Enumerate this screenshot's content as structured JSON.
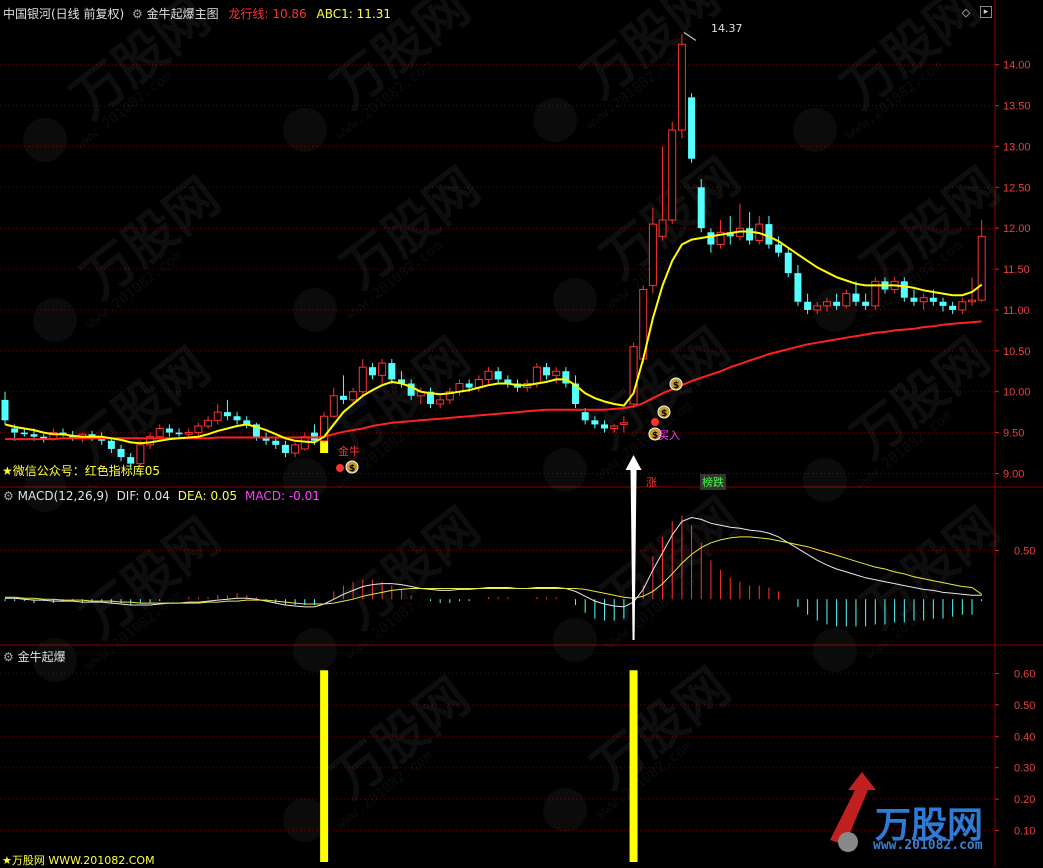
{
  "main_header": {
    "security": "中国银河(日线 前复权)",
    "indicator": "金牛起爆主图",
    "line1_label": "龙行线:",
    "line1_value": "10.86",
    "line2_label": "ABC1:",
    "line2_value": "11.31"
  },
  "macd_header": {
    "name": "MACD(12,26,9)",
    "dif_label": "DIF:",
    "dif_value": "0.04",
    "dea_label": "DEA:",
    "dea_value": "0.05",
    "macd_label": "MACD:",
    "macd_value": "-0.01"
  },
  "sub_header": {
    "name": "金牛起爆"
  },
  "annotations": {
    "wechat": "★微信公众号：红色指标库05",
    "high_price": "14.37",
    "jinniu": "金牛",
    "buy": "买入",
    "up_label": "涨",
    "rank_label": "榜跌"
  },
  "watermark": {
    "brand": "万股网",
    "url_footer": "WWW.201082.COM",
    "url_logo": "www.201082.com",
    "footer_brand": "万股网"
  },
  "colors": {
    "up": "#ff3232",
    "down": "#54ffff",
    "yellow": "#ffff00",
    "ma_red": "#ff2020",
    "grid": "#8b0000"
  },
  "icons": [
    "gear-icon",
    "diamond-icon",
    "expand-icon",
    "money-bag-icon",
    "up-arrow-icon"
  ],
  "chart_data": [
    {
      "type": "candlestick",
      "title": "金牛起爆主图",
      "y_ticks": [
        "9.00",
        "9.50",
        "10.00",
        "10.50",
        "11.00",
        "11.50",
        "12.00",
        "12.50",
        "13.00",
        "13.50",
        "14.00"
      ],
      "ylim": [
        8.92,
        14.62
      ],
      "candles": [
        [
          9.9,
          10.0,
          9.6,
          9.65
        ],
        [
          9.55,
          9.6,
          9.4,
          9.5
        ],
        [
          9.5,
          9.55,
          9.45,
          9.48
        ],
        [
          9.48,
          9.55,
          9.4,
          9.45
        ],
        [
          9.45,
          9.48,
          9.38,
          9.42
        ],
        [
          9.42,
          9.55,
          9.4,
          9.5
        ],
        [
          9.5,
          9.55,
          9.45,
          9.47
        ],
        [
          9.47,
          9.52,
          9.4,
          9.44
        ],
        [
          9.44,
          9.5,
          9.38,
          9.48
        ],
        [
          9.48,
          9.52,
          9.4,
          9.42
        ],
        [
          9.42,
          9.5,
          9.35,
          9.4
        ],
        [
          9.4,
          9.42,
          9.25,
          9.3
        ],
        [
          9.3,
          9.35,
          9.15,
          9.2
        ],
        [
          9.2,
          9.25,
          9.05,
          9.12
        ],
        [
          9.12,
          9.4,
          9.1,
          9.35
        ],
        [
          9.35,
          9.5,
          9.3,
          9.45
        ],
        [
          9.45,
          9.6,
          9.4,
          9.55
        ],
        [
          9.55,
          9.6,
          9.45,
          9.5
        ],
        [
          9.5,
          9.55,
          9.45,
          9.48
        ],
        [
          9.48,
          9.55,
          9.42,
          9.5
        ],
        [
          9.5,
          9.62,
          9.45,
          9.58
        ],
        [
          9.58,
          9.7,
          9.55,
          9.65
        ],
        [
          9.65,
          9.85,
          9.6,
          9.75
        ],
        [
          9.75,
          9.9,
          9.65,
          9.7
        ],
        [
          9.7,
          9.75,
          9.6,
          9.65
        ],
        [
          9.65,
          9.7,
          9.55,
          9.6
        ],
        [
          9.6,
          9.62,
          9.4,
          9.45
        ],
        [
          9.45,
          9.5,
          9.35,
          9.4
        ],
        [
          9.4,
          9.45,
          9.3,
          9.35
        ],
        [
          9.35,
          9.4,
          9.2,
          9.25
        ],
        [
          9.25,
          9.38,
          9.2,
          9.35
        ],
        [
          9.3,
          9.5,
          9.28,
          9.45
        ],
        [
          9.5,
          9.6,
          9.35,
          9.4
        ],
        [
          9.4,
          9.75,
          9.38,
          9.7
        ],
        [
          9.7,
          10.05,
          9.68,
          9.95
        ],
        [
          9.95,
          10.2,
          9.85,
          9.9
        ],
        [
          9.9,
          10.05,
          9.85,
          10.0
        ],
        [
          10.0,
          10.4,
          9.95,
          10.3
        ],
        [
          10.3,
          10.35,
          10.15,
          10.2
        ],
        [
          10.2,
          10.4,
          10.1,
          10.35
        ],
        [
          10.35,
          10.4,
          10.1,
          10.15
        ],
        [
          10.15,
          10.25,
          10.05,
          10.1
        ],
        [
          10.1,
          10.15,
          9.9,
          9.95
        ],
        [
          9.95,
          10.05,
          9.85,
          10.0
        ],
        [
          10.0,
          10.05,
          9.8,
          9.85
        ],
        [
          9.85,
          9.95,
          9.8,
          9.9
        ],
        [
          9.9,
          10.05,
          9.85,
          10.0
        ],
        [
          10.0,
          10.15,
          9.95,
          10.1
        ],
        [
          10.1,
          10.15,
          10.0,
          10.05
        ],
        [
          10.05,
          10.2,
          10.0,
          10.15
        ],
        [
          10.15,
          10.3,
          10.1,
          10.25
        ],
        [
          10.25,
          10.3,
          10.1,
          10.15
        ],
        [
          10.15,
          10.2,
          10.05,
          10.1
        ],
        [
          10.1,
          10.15,
          10.0,
          10.05
        ],
        [
          10.05,
          10.15,
          10.0,
          10.1
        ],
        [
          10.1,
          10.35,
          10.05,
          10.3
        ],
        [
          10.3,
          10.35,
          10.15,
          10.2
        ],
        [
          10.2,
          10.3,
          10.1,
          10.25
        ],
        [
          10.25,
          10.3,
          10.05,
          10.1
        ],
        [
          10.1,
          10.2,
          9.8,
          9.85
        ],
        [
          9.75,
          9.8,
          9.6,
          9.65
        ],
        [
          9.65,
          9.7,
          9.55,
          9.6
        ],
        [
          9.6,
          9.65,
          9.5,
          9.55
        ],
        [
          9.55,
          9.6,
          9.5,
          9.58
        ],
        [
          9.6,
          9.7,
          9.5,
          9.62
        ],
        [
          9.85,
          10.6,
          9.8,
          10.55
        ],
        [
          10.4,
          11.3,
          10.35,
          11.25
        ],
        [
          11.3,
          12.25,
          11.2,
          12.05
        ],
        [
          11.9,
          13.0,
          11.85,
          12.1
        ],
        [
          12.1,
          13.3,
          12.05,
          13.2
        ],
        [
          13.2,
          14.37,
          13.1,
          14.25
        ],
        [
          13.6,
          13.65,
          12.8,
          12.85
        ],
        [
          12.5,
          12.6,
          11.95,
          12.0
        ],
        [
          11.95,
          12.0,
          11.7,
          11.8
        ],
        [
          11.8,
          12.1,
          11.75,
          11.95
        ],
        [
          11.95,
          12.15,
          11.8,
          11.9
        ],
        [
          11.9,
          12.3,
          11.85,
          12.0
        ],
        [
          12.0,
          12.2,
          11.8,
          11.85
        ],
        [
          11.85,
          12.15,
          11.8,
          12.05
        ],
        [
          12.05,
          12.15,
          11.75,
          11.8
        ],
        [
          11.8,
          11.9,
          11.65,
          11.7
        ],
        [
          11.7,
          11.75,
          11.4,
          11.45
        ],
        [
          11.45,
          11.55,
          11.05,
          11.1
        ],
        [
          11.1,
          11.2,
          10.95,
          11.0
        ],
        [
          11.0,
          11.1,
          10.95,
          11.05
        ],
        [
          11.05,
          11.15,
          10.98,
          11.1
        ],
        [
          11.1,
          11.2,
          11.0,
          11.05
        ],
        [
          11.05,
          11.25,
          11.02,
          11.2
        ],
        [
          11.2,
          11.35,
          11.05,
          11.1
        ],
        [
          11.1,
          11.2,
          11.0,
          11.05
        ],
        [
          11.05,
          11.4,
          11.0,
          11.35
        ],
        [
          11.35,
          11.4,
          11.2,
          11.25
        ],
        [
          11.25,
          11.4,
          11.2,
          11.35
        ],
        [
          11.35,
          11.4,
          11.1,
          11.15
        ],
        [
          11.15,
          11.25,
          11.05,
          11.1
        ],
        [
          11.1,
          11.2,
          11.0,
          11.15
        ],
        [
          11.15,
          11.25,
          11.05,
          11.1
        ],
        [
          11.1,
          11.15,
          10.98,
          11.05
        ],
        [
          11.05,
          11.1,
          10.95,
          11.0
        ],
        [
          11.0,
          11.15,
          10.95,
          11.1
        ],
        [
          11.1,
          11.4,
          11.05,
          11.12
        ],
        [
          11.12,
          12.1,
          11.1,
          11.9
        ]
      ],
      "line_yellow": [
        9.6,
        9.57,
        9.55,
        9.53,
        9.5,
        9.48,
        9.48,
        9.46,
        9.45,
        9.45,
        9.45,
        9.43,
        9.41,
        9.38,
        9.37,
        9.38,
        9.4,
        9.42,
        9.43,
        9.44,
        9.45,
        9.48,
        9.52,
        9.55,
        9.58,
        9.6,
        9.57,
        9.53,
        9.48,
        9.43,
        9.4,
        9.39,
        9.38,
        9.45,
        9.6,
        9.75,
        9.85,
        9.95,
        10.02,
        10.08,
        10.12,
        10.1,
        10.06,
        10.0,
        9.98,
        9.97,
        9.98,
        10.0,
        10.02,
        10.05,
        10.08,
        10.1,
        10.1,
        10.08,
        10.08,
        10.1,
        10.12,
        10.15,
        10.15,
        10.08,
        9.98,
        9.92,
        9.88,
        9.85,
        9.83,
        9.98,
        10.4,
        10.9,
        11.3,
        11.6,
        11.8,
        11.86,
        11.88,
        11.9,
        11.92,
        11.94,
        11.96,
        11.96,
        11.94,
        11.9,
        11.84,
        11.76,
        11.68,
        11.6,
        11.52,
        11.46,
        11.4,
        11.36,
        11.32,
        11.3,
        11.3,
        11.3,
        11.3,
        11.29,
        11.27,
        11.24,
        11.22,
        11.2,
        11.18,
        11.18,
        11.22,
        11.31
      ],
      "line_red": [
        9.42,
        9.42,
        9.42,
        9.42,
        9.42,
        9.42,
        9.43,
        9.43,
        9.43,
        9.43,
        9.43,
        9.43,
        9.43,
        9.43,
        9.43,
        9.43,
        9.43,
        9.43,
        9.43,
        9.43,
        9.43,
        9.43,
        9.44,
        9.44,
        9.44,
        9.44,
        9.44,
        9.44,
        9.44,
        9.44,
        9.44,
        9.44,
        9.44,
        9.45,
        9.48,
        9.51,
        9.53,
        9.55,
        9.58,
        9.6,
        9.62,
        9.63,
        9.64,
        9.65,
        9.66,
        9.67,
        9.68,
        9.69,
        9.7,
        9.71,
        9.72,
        9.73,
        9.74,
        9.75,
        9.76,
        9.77,
        9.78,
        9.78,
        9.78,
        9.78,
        9.78,
        9.78,
        9.78,
        9.79,
        9.8,
        9.82,
        9.86,
        9.92,
        9.98,
        10.03,
        10.08,
        10.13,
        10.17,
        10.21,
        10.25,
        10.3,
        10.34,
        10.38,
        10.42,
        10.46,
        10.49,
        10.52,
        10.55,
        10.58,
        10.6,
        10.62,
        10.64,
        10.66,
        10.68,
        10.7,
        10.72,
        10.73,
        10.75,
        10.76,
        10.77,
        10.79,
        10.8,
        10.82,
        10.83,
        10.84,
        10.85,
        10.86
      ],
      "signal_bars": [
        {
          "index": 33,
          "from": 9.25,
          "to": 9.7
        },
        {
          "index": 65,
          "from": 9.85,
          "to": 10.55
        }
      ]
    },
    {
      "type": "line",
      "title": "MACD(12,26,9)",
      "y_ticks": [
        "0.50"
      ],
      "ylim": [
        -0.42,
        1.02
      ],
      "dif": [
        0.01,
        0.01,
        0.0,
        -0.01,
        -0.01,
        -0.02,
        -0.02,
        -0.02,
        -0.03,
        -0.03,
        -0.03,
        -0.04,
        -0.05,
        -0.06,
        -0.06,
        -0.06,
        -0.05,
        -0.04,
        -0.04,
        -0.03,
        -0.03,
        -0.02,
        -0.01,
        0.0,
        0.01,
        0.01,
        0.0,
        -0.02,
        -0.04,
        -0.06,
        -0.07,
        -0.08,
        -0.08,
        -0.05,
        0.0,
        0.05,
        0.09,
        0.13,
        0.15,
        0.16,
        0.16,
        0.15,
        0.13,
        0.11,
        0.1,
        0.09,
        0.09,
        0.1,
        0.1,
        0.11,
        0.12,
        0.12,
        0.12,
        0.11,
        0.11,
        0.12,
        0.12,
        0.12,
        0.11,
        0.08,
        0.03,
        -0.02,
        -0.05,
        -0.07,
        -0.08,
        -0.03,
        0.1,
        0.3,
        0.48,
        0.66,
        0.8,
        0.84,
        0.82,
        0.78,
        0.76,
        0.74,
        0.73,
        0.71,
        0.7,
        0.68,
        0.64,
        0.58,
        0.52,
        0.46,
        0.4,
        0.35,
        0.31,
        0.28,
        0.25,
        0.22,
        0.2,
        0.18,
        0.16,
        0.14,
        0.12,
        0.1,
        0.09,
        0.07,
        0.06,
        0.05,
        0.04,
        0.04
      ],
      "dea": [
        0.02,
        0.02,
        0.01,
        0.01,
        0.0,
        0.0,
        -0.01,
        -0.01,
        -0.01,
        -0.02,
        -0.02,
        -0.02,
        -0.03,
        -0.03,
        -0.04,
        -0.04,
        -0.04,
        -0.04,
        -0.04,
        -0.04,
        -0.04,
        -0.03,
        -0.03,
        -0.02,
        -0.02,
        -0.01,
        -0.01,
        -0.01,
        -0.02,
        -0.03,
        -0.04,
        -0.05,
        -0.05,
        -0.05,
        -0.04,
        -0.02,
        0.0,
        0.03,
        0.05,
        0.07,
        0.09,
        0.1,
        0.11,
        0.11,
        0.11,
        0.11,
        0.11,
        0.11,
        0.11,
        0.11,
        0.11,
        0.11,
        0.11,
        0.11,
        0.11,
        0.11,
        0.11,
        0.11,
        0.11,
        0.11,
        0.1,
        0.08,
        0.06,
        0.04,
        0.02,
        0.01,
        0.03,
        0.08,
        0.16,
        0.26,
        0.37,
        0.46,
        0.53,
        0.58,
        0.61,
        0.63,
        0.64,
        0.64,
        0.63,
        0.62,
        0.6,
        0.58,
        0.56,
        0.54,
        0.51,
        0.48,
        0.45,
        0.42,
        0.39,
        0.36,
        0.33,
        0.31,
        0.28,
        0.26,
        0.23,
        0.21,
        0.19,
        0.17,
        0.15,
        0.13,
        0.12,
        0.05
      ]
    },
    {
      "type": "bar",
      "title": "金牛起爆",
      "y_ticks": [
        "0.10",
        "0.20",
        "0.30",
        "0.40",
        "0.50",
        "0.60"
      ],
      "ylim": [
        0.0,
        0.63
      ],
      "bars": [
        {
          "index": 33,
          "value": 0.61
        },
        {
          "index": 65,
          "value": 0.61
        }
      ]
    }
  ]
}
